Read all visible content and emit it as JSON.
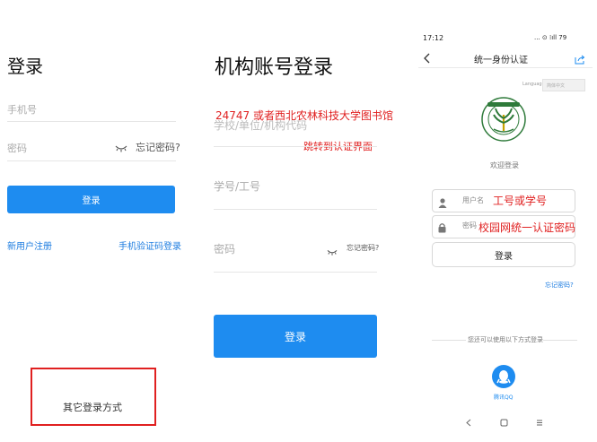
{
  "panel1": {
    "title": "登录",
    "phone_placeholder": "手机号",
    "password_placeholder": "密码",
    "forgot_password": "忘记密码?",
    "login_button": "登录",
    "register_link": "新用户注册",
    "sms_login_link": "手机验证码登录",
    "other_login": "其它登录方式"
  },
  "panel2": {
    "title": "机构账号登录",
    "school_placeholder": "学校/单位/机构代码",
    "annotation_school": "24747 或者西北农林科技大学图书馆",
    "annotation_redirect": "跳转到认证界面",
    "id_placeholder": "学号/工号",
    "password_placeholder": "密码",
    "forgot_password": "忘记密码?",
    "login_button": "登录"
  },
  "panel3": {
    "status_time": "17:12",
    "status_icons": "... ⊙ ⁞ıll 79",
    "header_title": "统一身份认证",
    "language_label": "Language:",
    "language_value": "简体中文",
    "welcome": "欢迎登录",
    "username_placeholder": "用户名",
    "username_annotation": "工号或学号",
    "password_placeholder": "密码",
    "password_annotation": "校园网统一认证密码",
    "login_button": "登录",
    "forgot_password": "忘记密码?",
    "other_methods": "您还可以使用以下方式登录",
    "qq_label": "腾讯QQ",
    "logo_ring_text": "西北农林科技大学 NORTHWEST A&F UNIVERSITY"
  },
  "colors": {
    "primary_blue": "#1e8cf0",
    "link_blue": "#1e7de0",
    "annotation_red": "#e02020"
  }
}
